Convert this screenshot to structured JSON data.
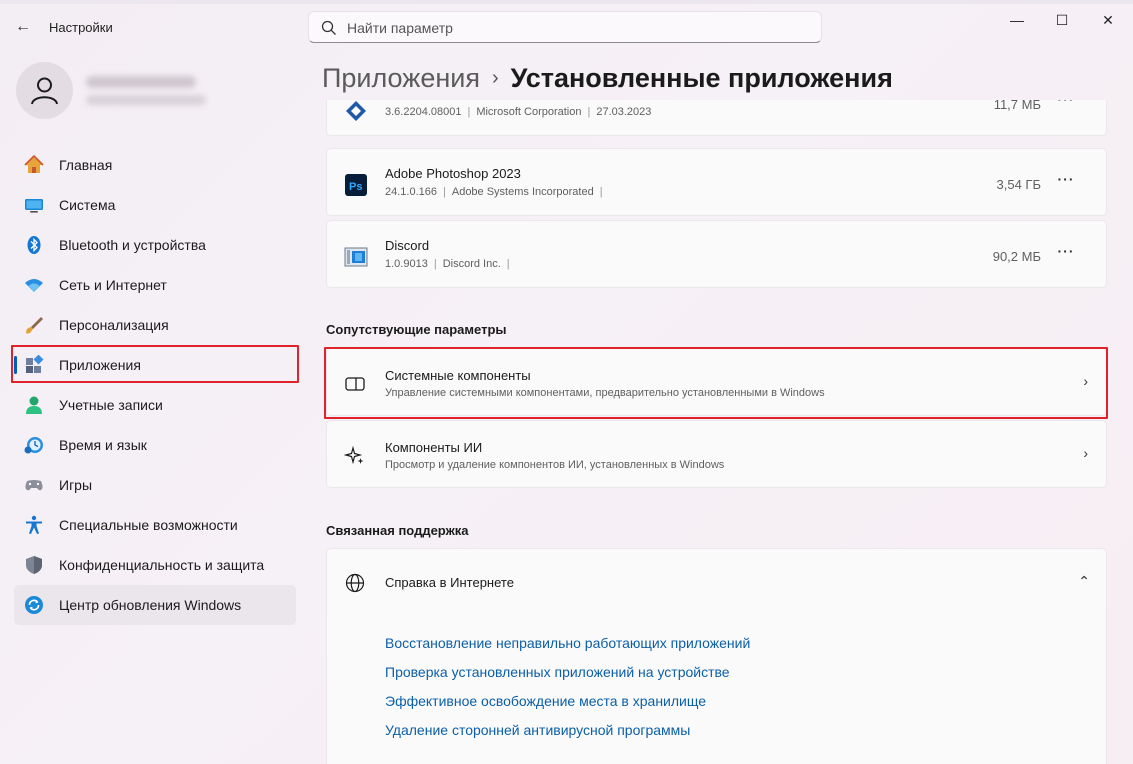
{
  "window": {
    "title": "Настройки",
    "controls": {
      "minimize": "—",
      "maximize": "☐",
      "close": "✕"
    }
  },
  "search": {
    "placeholder": "Найти параметр"
  },
  "sidebar": {
    "items": [
      {
        "label": "Главная",
        "icon": "home-icon"
      },
      {
        "label": "Система",
        "icon": "system-icon"
      },
      {
        "label": "Bluetooth и устройства",
        "icon": "bluetooth-icon"
      },
      {
        "label": "Сеть и Интернет",
        "icon": "wifi-icon"
      },
      {
        "label": "Персонализация",
        "icon": "brush-icon"
      },
      {
        "label": "Приложения",
        "icon": "apps-icon"
      },
      {
        "label": "Учетные записи",
        "icon": "accounts-icon"
      },
      {
        "label": "Время и язык",
        "icon": "time-language-icon"
      },
      {
        "label": "Игры",
        "icon": "gamepad-icon"
      },
      {
        "label": "Специальные возможности",
        "icon": "accessibility-icon"
      },
      {
        "label": "Конфиденциальность и защита",
        "icon": "shield-icon"
      },
      {
        "label": "Центр обновления Windows",
        "icon": "update-icon"
      }
    ],
    "active_index": 5,
    "hover_index": 11
  },
  "breadcrumb": {
    "parent": "Приложения",
    "separator": "›",
    "current": "Установленные приложения"
  },
  "apps": [
    {
      "name": "",
      "version": "3.6.2204.08001",
      "publisher": "Microsoft Corporation",
      "date": "27.03.2023",
      "size": "11,7 МБ",
      "icon": "app-icon"
    },
    {
      "name": "Adobe Photoshop 2023",
      "version": "24.1.0.166",
      "publisher": "Adobe Systems Incorporated",
      "date": "",
      "size": "3,54 ГБ",
      "icon": "photoshop-icon"
    },
    {
      "name": "Discord",
      "version": "1.0.9013",
      "publisher": "Discord Inc.",
      "date": "",
      "size": "90,2 МБ",
      "icon": "discord-icon"
    }
  ],
  "more_label": "···",
  "related": {
    "title": "Сопутствующие параметры",
    "items": [
      {
        "title": "Системные компоненты",
        "desc": "Управление системными компонентами, предварительно установленными в Windows",
        "icon": "system-components-icon"
      },
      {
        "title": "Компоненты ИИ",
        "desc": "Просмотр и удаление компонентов ИИ, установленных в Windows",
        "icon": "sparkle-icon"
      }
    ]
  },
  "support": {
    "title": "Связанная поддержка",
    "head": "Справка в Интернете",
    "links": [
      "Восстановление неправильно работающих приложений",
      "Проверка установленных приложений на устройстве",
      "Эффективное освобождение места в хранилище",
      "Удаление сторонней антивирусной программы"
    ]
  },
  "accent_color": "#005fb8",
  "highlight_color": "#e0232a"
}
